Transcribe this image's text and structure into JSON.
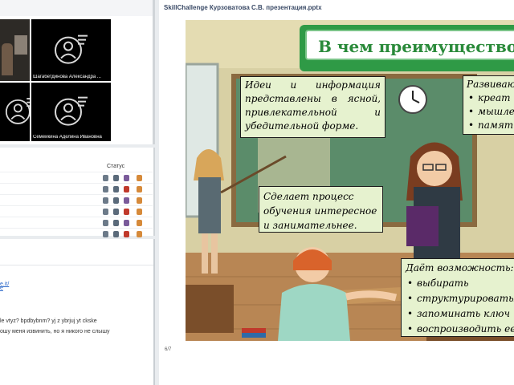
{
  "videos": {
    "tiles": [
      {
        "name": ""
      },
      {
        "name": "Шагабетдинова Александра ..."
      },
      {
        "name": ""
      },
      {
        "name": "Семейкина Аделина Ивановна"
      }
    ]
  },
  "participants": {
    "status_header": "Статус",
    "row_count": 6
  },
  "chat": {
    "lines": [
      {
        "text": "e",
        "kind": "link"
      },
      {
        "text": "e.it/",
        "kind": "link"
      },
      {
        "text": "le vtyz? bpdbybnm? yj z ybrjuj yt ckske",
        "kind": "text"
      },
      {
        "text": "ошу меня извинить, но я никого не слышу",
        "kind": "text"
      }
    ]
  },
  "presentation": {
    "file_title": "SkillChallenge Курзоватова С.В. презентация.pptx",
    "page": "6/7",
    "slide": {
      "title": "В чем преимущество?",
      "box1_text": "Идеи и информация представлены в ясной, привлекательной и убедительной форме.",
      "box2_head": "Развиваю",
      "box2_items": [
        "креат",
        "мышле",
        "памят"
      ],
      "box3_text": "Сделает процесс обучения интересное и занимательнее.",
      "box4_head": "Даёт возможность:",
      "box4_items": [
        "выбирать",
        "структурироваты",
        "запоминать ключ",
        "воспроизводить ее"
      ]
    }
  },
  "colors": {
    "title_green": "#2f9a46",
    "note_bg": "#e6f2cf",
    "wall": "#d8d0a4",
    "floor": "#b88654",
    "board": "#5b8c6a"
  }
}
